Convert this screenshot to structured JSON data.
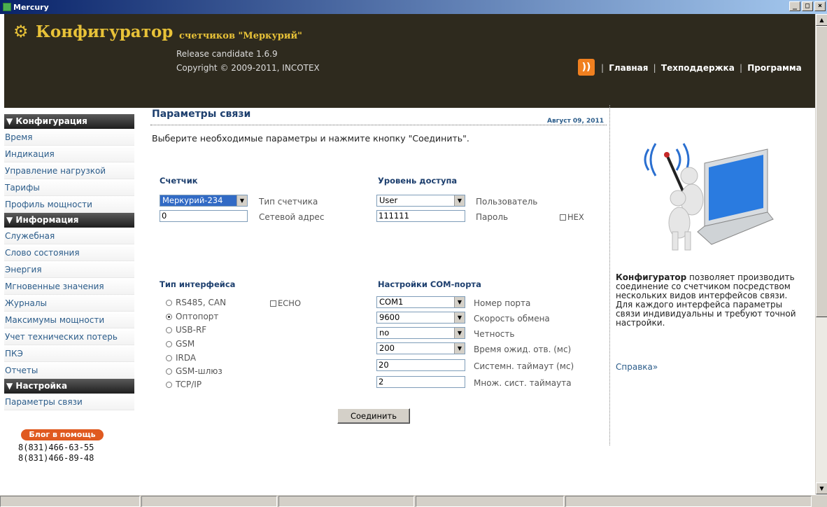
{
  "window": {
    "title": "Mercury",
    "buttons": [
      "_",
      "□",
      "×"
    ]
  },
  "header": {
    "brand": "Конфигуратор",
    "subtitle": "счетчиков \"Меркурий\"",
    "release": "Release candidate 1.6.9",
    "copyright": "Copyright © 2009-2011, INCOTEX",
    "nav": [
      "Главная",
      "Техподдержка",
      "Программа"
    ]
  },
  "sidebar": {
    "sections": [
      {
        "title": "▼ Конфигурация",
        "items": [
          "Время",
          "Индикация",
          "Управление нагрузкой",
          "Тарифы",
          "Профиль мощности"
        ]
      },
      {
        "title": "▼ Информация",
        "items": [
          "Служебная",
          "Слово состояния",
          "Энергия",
          "Мгновенные значения",
          "Журналы",
          "Максимумы мощности",
          "Учет технических потерь",
          "ПКЭ",
          "Отчеты"
        ]
      },
      {
        "title": "▼ Настройка",
        "items": [
          "Параметры связи"
        ]
      }
    ],
    "blog": "Блог в помощь",
    "phones": [
      "8(831)466-63-55",
      "8(831)466-89-48"
    ]
  },
  "main": {
    "title": "Параметры связи",
    "date": "Август 09, 2011",
    "instruction": "Выберите необходимые параметры и нажмите кнопку \"Соединить\".",
    "meter": {
      "title": "Счетчик",
      "type_value": "Меркурий-234",
      "type_label": "Тип счетчика",
      "address_value": "0",
      "address_label": "Сетевой адрес"
    },
    "access": {
      "title": "Уровень доступа",
      "user_value": "User",
      "user_label": "Пользователь",
      "password_value": "111111",
      "password_label": "Пароль",
      "hex_label": "HEX"
    },
    "interface": {
      "title": "Тип интерфейса",
      "echo_label": "ECHO",
      "options": [
        "RS485, CAN",
        "Оптопорт",
        "USB-RF",
        "GSM",
        "IRDA",
        "GSM-шлюз",
        "TCP/IP"
      ],
      "selected": "Оптопорт"
    },
    "com": {
      "title": "Настройки COM-порта",
      "port_value": "COM1",
      "port_label": "Номер порта",
      "speed_value": "9600",
      "speed_label": "Скорость обмена",
      "parity_value": "no",
      "parity_label": "Четность",
      "wait_value": "200",
      "wait_label": "Время ожид. отв. (мс)",
      "timeout_value": "20",
      "timeout_label": "Системн. таймаут (мс)",
      "mult_value": "2",
      "mult_label": "Множ. сист. таймаута"
    },
    "connect_button": "Соединить"
  },
  "right": {
    "info_bold": "Конфигуратор",
    "info_text": " позволяет производить соединение со счетчиком посредством нескольких видов интерфейсов связи. Для каждого интерфейса параметры связи индивидуальны и требуют точной настройки.",
    "help_link": "Справка»"
  },
  "colors": {
    "header_bg": "#2e2a1e",
    "brand": "#e8c238",
    "link": "#2b5c8a",
    "title": "#1d3f6e",
    "blog": "#e05a20"
  }
}
